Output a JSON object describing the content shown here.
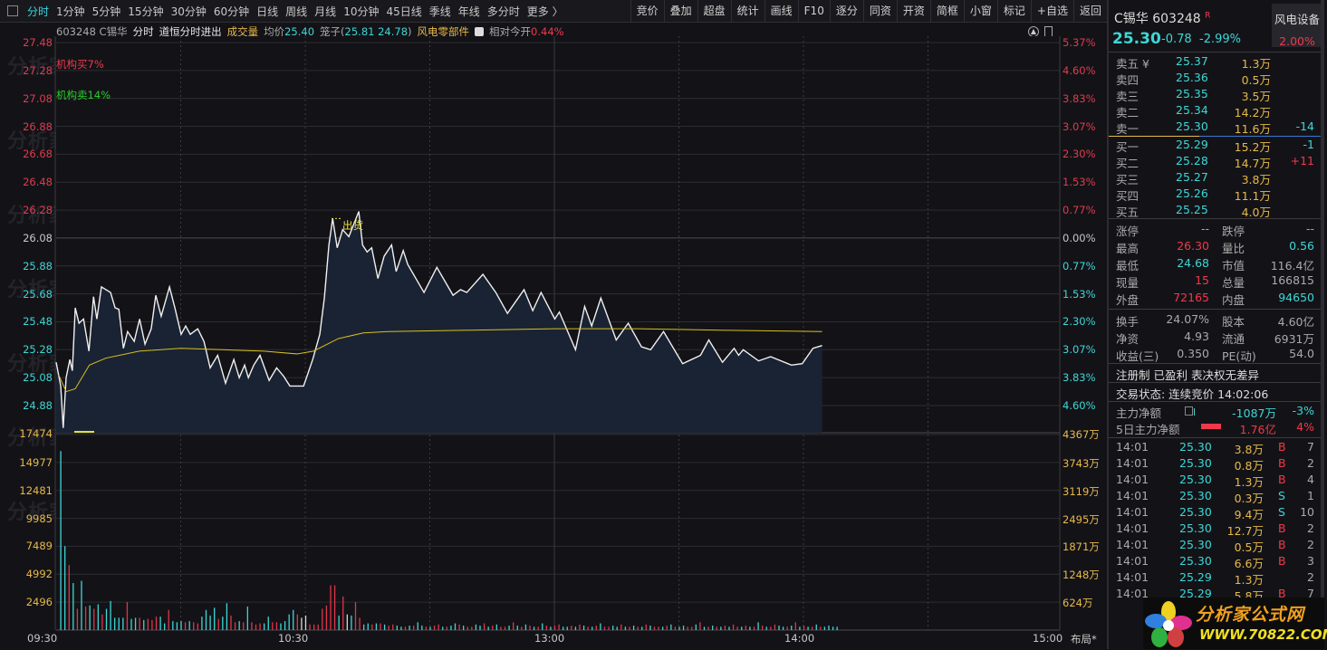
{
  "toolbar": {
    "tabs": [
      "分时",
      "1分钟",
      "5分钟",
      "15分钟",
      "30分钟",
      "60分钟",
      "日线",
      "周线",
      "月线",
      "10分钟",
      "45日线",
      "季线",
      "年线",
      "多分时",
      "更多 〉"
    ],
    "buttons": [
      "竞价",
      "叠加",
      "超盘",
      "统计",
      "画线",
      "F10",
      "逐分",
      "同资",
      "开资",
      "简框",
      "小窗",
      "标记",
      "+自选",
      "返回"
    ]
  },
  "info": {
    "code_name": "603248 C锡华",
    "mode": "分时",
    "indicator": "道恒分时进出",
    "volume_label": "成交量",
    "avg_label": "均价",
    "avg_value": "25.40",
    "cage_label": "笼子(",
    "cage_values": "25.81 24.78",
    "cage_close": ")",
    "sector": "风电零部件",
    "rel_label": "相对今开",
    "rel_value": "0.44%"
  },
  "annotations": {
    "inst_buy": "机构买7%",
    "inst_sell": "机构卖14%",
    "sell_signal": "出货"
  },
  "watermark": "分析家公式网www.70822.com",
  "layout_label": "布局*",
  "chart_data": {
    "type": "line",
    "title": "分时",
    "prev_close": 26.08,
    "ylim": [
      24.88,
      27.48
    ],
    "price_ticks": [
      "27.48",
      "27.28",
      "27.08",
      "26.88",
      "26.68",
      "26.48",
      "26.28",
      "26.08",
      "25.88",
      "25.68",
      "25.48",
      "25.28",
      "25.08",
      "24.88"
    ],
    "pct_ticks": [
      "5.37%",
      "4.60%",
      "3.83%",
      "3.07%",
      "2.30%",
      "1.53%",
      "0.77%",
      "0.00%",
      "0.77%",
      "1.53%",
      "2.30%",
      "3.07%",
      "3.83%",
      "4.60%"
    ],
    "vol_ticks": [
      "17474",
      "14977",
      "12481",
      "9985",
      "7489",
      "4992",
      "2496"
    ],
    "vol_ticks_right": [
      "4367万",
      "3743万",
      "3119万",
      "2495万",
      "1871万",
      "1248万",
      "624万"
    ],
    "vol_max": 17474,
    "time_ticks": [
      "09:30",
      "10:30",
      "13:00",
      "14:00",
      "15:00"
    ],
    "x_range": [
      0,
      240
    ],
    "price": [
      [
        0,
        25.19
      ],
      [
        1.1,
        25.02
      ],
      [
        1.7,
        24.72
      ],
      [
        2.4,
        25.08
      ],
      [
        3.3,
        25.21
      ],
      [
        3.9,
        25.13
      ],
      [
        4.6,
        25.58
      ],
      [
        5.5,
        25.47
      ],
      [
        6.6,
        25.5
      ],
      [
        7.9,
        25.27
      ],
      [
        9,
        25.66
      ],
      [
        9.8,
        25.5
      ],
      [
        10.9,
        25.73
      ],
      [
        13.1,
        25.69
      ],
      [
        14.2,
        25.58
      ],
      [
        15.1,
        25.57
      ],
      [
        16.2,
        25.29
      ],
      [
        17.2,
        25.41
      ],
      [
        18.8,
        25.34
      ],
      [
        20.1,
        25.5
      ],
      [
        21.4,
        25.32
      ],
      [
        22.9,
        25.43
      ],
      [
        24,
        25.67
      ],
      [
        25.3,
        25.52
      ],
      [
        27.3,
        25.73
      ],
      [
        28.6,
        25.58
      ],
      [
        30.1,
        25.39
      ],
      [
        31.2,
        25.45
      ],
      [
        32.3,
        25.39
      ],
      [
        34.1,
        25.43
      ],
      [
        35.6,
        25.34
      ],
      [
        37.1,
        25.15
      ],
      [
        38.9,
        25.24
      ],
      [
        40.8,
        25.04
      ],
      [
        42.8,
        25.21
      ],
      [
        44.1,
        25.08
      ],
      [
        45.4,
        25.17
      ],
      [
        46.3,
        25.08
      ],
      [
        47.6,
        25.17
      ],
      [
        49.1,
        25.24
      ],
      [
        51.3,
        25.06
      ],
      [
        53.1,
        25.15
      ],
      [
        54.8,
        25.09
      ],
      [
        56.3,
        25.02
      ],
      [
        59.6,
        25.02
      ],
      [
        61.8,
        25.21
      ],
      [
        63.5,
        25.39
      ],
      [
        64.6,
        25.65
      ],
      [
        65.7,
        26.03
      ],
      [
        66.6,
        26.22
      ],
      [
        67.7,
        26.01
      ],
      [
        69,
        26.14
      ],
      [
        70.5,
        26.09
      ],
      [
        72.1,
        26.21
      ],
      [
        72.9,
        26.27
      ],
      [
        73.8,
        26.03
      ],
      [
        74.9,
        25.98
      ],
      [
        76,
        26.01
      ],
      [
        77.5,
        25.79
      ],
      [
        79,
        25.95
      ],
      [
        80.8,
        26.03
      ],
      [
        81.9,
        25.84
      ],
      [
        83.6,
        25.99
      ],
      [
        84.7,
        25.89
      ],
      [
        88.6,
        25.69
      ],
      [
        91.7,
        25.87
      ],
      [
        95.6,
        25.67
      ],
      [
        97.4,
        25.71
      ],
      [
        98.9,
        25.69
      ],
      [
        102.8,
        25.82
      ],
      [
        105.9,
        25.69
      ],
      [
        108.7,
        25.54
      ],
      [
        112.7,
        25.71
      ],
      [
        114.8,
        25.56
      ],
      [
        116.8,
        25.69
      ],
      [
        120.1,
        25.5
      ],
      [
        121.2,
        25.55
      ],
      [
        125.1,
        25.28
      ],
      [
        127.3,
        25.59
      ],
      [
        129,
        25.45
      ],
      [
        131.2,
        25.65
      ],
      [
        134.9,
        25.35
      ],
      [
        137.8,
        25.47
      ],
      [
        141,
        25.3
      ],
      [
        143.2,
        25.28
      ],
      [
        146.3,
        25.41
      ],
      [
        150.9,
        25.18
      ],
      [
        155.2,
        25.24
      ],
      [
        157.2,
        25.35
      ],
      [
        160.5,
        25.19
      ],
      [
        163.3,
        25.29
      ],
      [
        164.4,
        25.24
      ],
      [
        165.5,
        25.28
      ],
      [
        169.2,
        25.2
      ],
      [
        172.1,
        25.23
      ],
      [
        177.1,
        25.17
      ],
      [
        179.7,
        25.18
      ],
      [
        182.3,
        25.29
      ],
      [
        184.5,
        25.31
      ]
    ],
    "avg_price": [
      [
        0.6,
        25.1
      ],
      [
        2.4,
        24.98
      ],
      [
        4.6,
        25.0
      ],
      [
        8,
        25.17
      ],
      [
        12,
        25.22
      ],
      [
        20,
        25.27
      ],
      [
        30,
        25.29
      ],
      [
        40,
        25.28
      ],
      [
        50,
        25.27
      ],
      [
        58,
        25.25
      ],
      [
        62,
        25.27
      ],
      [
        68,
        25.36
      ],
      [
        74,
        25.4
      ],
      [
        80,
        25.41
      ],
      [
        100,
        25.42
      ],
      [
        120,
        25.43
      ],
      [
        140,
        25.43
      ],
      [
        160,
        25.42
      ],
      [
        184.5,
        25.41
      ]
    ],
    "volume": [
      16000,
      7500,
      5800,
      4200,
      1900,
      4400,
      2100,
      2200,
      1900,
      2300,
      1400,
      1900,
      2600,
      1100,
      1100,
      1100,
      2500,
      1000,
      1100,
      1100,
      900,
      1000,
      900,
      1200,
      1200,
      600,
      1800,
      800,
      700,
      800,
      700,
      800,
      700,
      600,
      1200,
      1800,
      1300,
      2000,
      1000,
      1200,
      2400,
      1300,
      700,
      800,
      700,
      2100,
      700,
      500,
      600,
      600,
      1200,
      700,
      700,
      600,
      800,
      1400,
      1800,
      1400,
      1100,
      1300,
      500,
      500,
      500,
      1900,
      2200,
      4000,
      4000,
      1300,
      3000,
      1400,
      1300,
      2500,
      1100,
      500,
      600,
      500,
      600,
      600,
      500,
      400,
      500,
      400,
      300,
      300,
      400,
      400,
      700,
      400,
      300,
      300,
      400,
      500,
      300,
      300,
      400,
      600,
      500,
      400,
      300,
      300,
      500,
      400,
      600,
      300,
      400,
      500,
      300,
      300,
      400,
      700,
      400,
      300,
      500,
      400,
      300,
      300,
      600,
      400,
      300,
      400,
      500,
      300,
      300,
      400,
      300,
      500,
      400,
      300,
      300,
      400,
      600,
      300,
      300,
      400,
      300,
      500,
      300,
      300,
      400,
      300,
      300,
      500,
      400,
      300,
      300,
      300,
      400,
      500,
      300,
      300,
      400,
      300,
      300,
      500,
      700,
      300,
      300,
      400,
      300,
      300,
      400,
      300,
      500,
      300,
      300,
      400,
      300,
      300,
      700,
      400,
      300,
      300,
      500,
      400,
      300,
      300,
      400,
      700,
      300,
      400,
      300,
      300,
      500,
      300,
      300,
      400,
      300,
      300
    ],
    "volume_dir": "ccrcrcrcrcrcccccrccrcrrrccrcccrcrrccccrccrrcrcrrrccrrccc rwwrrrrrrrcrwcrrccrcrcrrccrcrccrcrrcrccrcrrccrcrcrrcrcrcrcrcrcrrccrcrcrcrcrrccrcrcrcrcrrcrcrccrrcrcrcrcrcrrcrcrcrcrrccrcrcrcrcr"
  },
  "quote": {
    "name": "C锡华 603248",
    "flag": "R",
    "sector": "风电设备",
    "sector_pct": "2.00%",
    "price": "25.30",
    "change": "-0.78",
    "change_pct": "-2.99%"
  },
  "orderbook": {
    "asks": [
      {
        "label": "卖五 ¥",
        "price": "25.37",
        "vol": "1.3万",
        "delta": ""
      },
      {
        "label": "卖四",
        "price": "25.36",
        "vol": "0.5万",
        "delta": ""
      },
      {
        "label": "卖三",
        "price": "25.35",
        "vol": "3.5万",
        "delta": ""
      },
      {
        "label": "卖二",
        "price": "25.34",
        "vol": "14.2万",
        "delta": ""
      },
      {
        "label": "卖一",
        "price": "25.30",
        "vol": "11.6万",
        "delta": "-14"
      }
    ],
    "bids": [
      {
        "label": "买一",
        "price": "25.29",
        "vol": "15.2万",
        "delta": "-1"
      },
      {
        "label": "买二",
        "price": "25.28",
        "vol": "14.7万",
        "delta": "+11"
      },
      {
        "label": "买三",
        "price": "25.27",
        "vol": "3.8万",
        "delta": ""
      },
      {
        "label": "买四",
        "price": "25.26",
        "vol": "11.1万",
        "delta": ""
      },
      {
        "label": "买五",
        "price": "25.25",
        "vol": "4.0万",
        "delta": ""
      }
    ]
  },
  "stats": [
    {
      "l1": "涨停",
      "v1": "--",
      "c1": "gy",
      "l2": "跌停",
      "v2": "--",
      "c2": "gy"
    },
    {
      "l1": "最高",
      "v1": "26.30",
      "c1": "rd",
      "l2": "量比",
      "v2": "0.56",
      "c2": "cy"
    },
    {
      "l1": "最低",
      "v1": "24.68",
      "c1": "cy",
      "l2": "市值",
      "v2": "116.4亿",
      "c2": "gy"
    },
    {
      "l1": "现量",
      "v1": "15",
      "c1": "rd",
      "l2": "总量",
      "v2": "166815",
      "c2": "gy"
    },
    {
      "l1": "外盘",
      "v1": "72165",
      "c1": "rd",
      "l2": "内盘",
      "v2": "94650",
      "c2": "cy"
    },
    {
      "l1": "换手",
      "v1": "24.07%",
      "c1": "gy",
      "l2": "股本",
      "v2": "4.60亿",
      "c2": "gy"
    },
    {
      "l1": "净资",
      "v1": "4.93",
      "c1": "gy",
      "l2": "流通",
      "v2": "6931万",
      "c2": "gy"
    },
    {
      "l1": "收益(三)",
      "v1": "0.350",
      "c1": "gy",
      "l2": "PE(动)",
      "v2": "54.0",
      "c2": "gy"
    }
  ],
  "tags": "注册制 已盈利 表决权无差异",
  "status": "交易状态: 连续竞价 14:02:06",
  "flow": [
    {
      "label": "主力净额",
      "value": "-1087万",
      "pct": "-3%",
      "color": "#3ed6d6"
    },
    {
      "label": "5日主力净额",
      "value": "1.76亿",
      "pct": "4%",
      "color": "#f0384c"
    }
  ],
  "trades": [
    {
      "t": "14:01",
      "p": "25.30",
      "v": "3.8万",
      "s": "B",
      "n": "7"
    },
    {
      "t": "14:01",
      "p": "25.30",
      "v": "0.8万",
      "s": "B",
      "n": "2"
    },
    {
      "t": "14:01",
      "p": "25.30",
      "v": "1.3万",
      "s": "B",
      "n": "4"
    },
    {
      "t": "14:01",
      "p": "25.30",
      "v": "0.3万",
      "s": "S",
      "n": "1"
    },
    {
      "t": "14:01",
      "p": "25.30",
      "v": "9.4万",
      "s": "S",
      "n": "10"
    },
    {
      "t": "14:01",
      "p": "25.30",
      "v": "12.7万",
      "s": "B",
      "n": "2"
    },
    {
      "t": "14:01",
      "p": "25.30",
      "v": "0.5万",
      "s": "B",
      "n": "2"
    },
    {
      "t": "14:01",
      "p": "25.30",
      "v": "6.6万",
      "s": "B",
      "n": "3"
    },
    {
      "t": "14:01",
      "p": "25.29",
      "v": "1.3万",
      "s": "",
      "n": "2"
    },
    {
      "t": "14:01",
      "p": "25.29",
      "v": "5.8万",
      "s": "B",
      "n": "7"
    }
  ],
  "logo": {
    "title": "分析家公式网",
    "url": "WWW.70822.COM"
  }
}
